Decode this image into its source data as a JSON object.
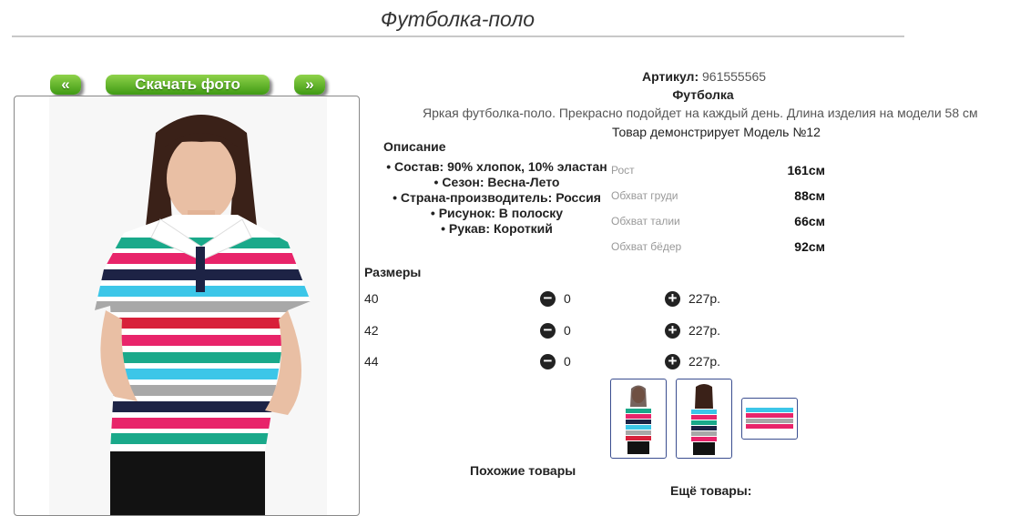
{
  "title": "Футболка-поло",
  "nav": {
    "prev": "«",
    "download": "Скачать фото",
    "next": "»"
  },
  "article": {
    "label": "Артикул:",
    "value": "961555565"
  },
  "category": "Футболка",
  "description_text": "Яркая футболка-поло. Прекрасно подойдет на каждый день. Длина изделия на модели 58 см",
  "model_note": "Товар демонстрирует Модель №12",
  "description_heading": "Описание",
  "properties": [
    "Состав: 90% хлопок, 10% эластан",
    "Сезон: Весна-Лето",
    "Страна-производитель: Россия",
    "Рисунок: В полоску",
    "Рукав: Короткий"
  ],
  "measurements": [
    {
      "label": "Рост",
      "value": "161см"
    },
    {
      "label": "Обхват груди",
      "value": "88см"
    },
    {
      "label": "Обхват талии",
      "value": "66см"
    },
    {
      "label": "Обхват бёдер",
      "value": "92см"
    }
  ],
  "sizes_heading": "Размеры",
  "sizes": [
    {
      "size": "40",
      "qty": "0",
      "price": "227р."
    },
    {
      "size": "42",
      "qty": "0",
      "price": "227р."
    },
    {
      "size": "44",
      "qty": "0",
      "price": "227р."
    }
  ],
  "icons": {
    "minus": "minus-circle-icon",
    "plus": "plus-circle-icon"
  },
  "similar_heading": "Похожие товары",
  "more_heading": "Ещё товары:",
  "colors": {
    "button_top": "#8fd24a",
    "button_bottom": "#3f9a14",
    "thumb_border": "#3a4d8f",
    "stripe_pink": "#e8246a",
    "stripe_teal": "#1aa98a",
    "stripe_cyan": "#3cc6e8",
    "stripe_navy": "#1d2345",
    "stripe_gray": "#a8a8a8",
    "stripe_red": "#d8203a"
  }
}
